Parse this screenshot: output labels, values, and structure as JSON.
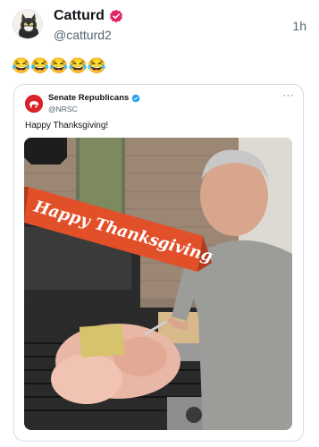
{
  "post": {
    "author_name": "Catturd",
    "author_handle": "@catturd2",
    "time": "1h",
    "text": "😂😂😂😂😂",
    "avatar_icon": "cat-avatar-icon",
    "badge_color": "#e0245e"
  },
  "quote": {
    "author_name": "Senate Republicans",
    "author_handle": "@NRSC",
    "more": "···",
    "text": "Happy Thanksgiving!",
    "badge_color": "#1d9bf0",
    "avatar_color": "#d8232a",
    "image": {
      "banner_text": "Happy Thanksgiving",
      "banner_color": "#e2502a"
    }
  }
}
